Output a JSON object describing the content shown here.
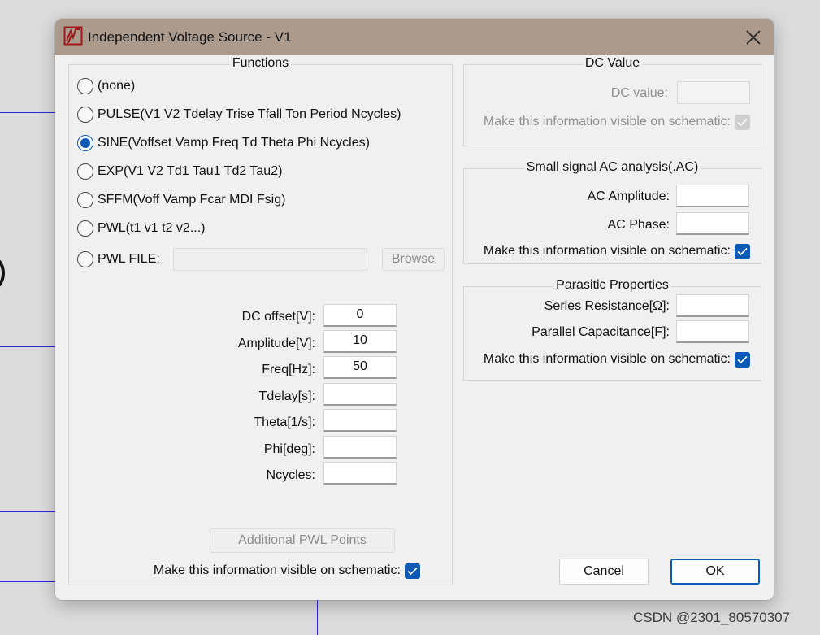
{
  "dialog": {
    "title": "Independent Voltage Source - V1",
    "title_icon": "ltspice-logo-icon",
    "close_icon": "close-icon"
  },
  "functions": {
    "title": "Functions",
    "options": [
      {
        "label": "(none)",
        "selected": false
      },
      {
        "label": "PULSE(V1 V2 Tdelay Trise Tfall Ton Period Ncycles)",
        "selected": false
      },
      {
        "label": "SINE(Voffset Vamp Freq Td Theta Phi Ncycles)",
        "selected": true
      },
      {
        "label": "EXP(V1 V2 Td1 Tau1 Td2 Tau2)",
        "selected": false
      },
      {
        "label": "SFFM(Voff Vamp Fcar MDI Fsig)",
        "selected": false
      },
      {
        "label": "PWL(t1 v1 t2 v2...)",
        "selected": false
      },
      {
        "label": "PWL FILE:",
        "selected": false
      }
    ],
    "pwl_file_value": "",
    "browse_label": "Browse",
    "params": [
      {
        "label": "DC offset[V]:",
        "value": "0"
      },
      {
        "label": "Amplitude[V]:",
        "value": "10"
      },
      {
        "label": "Freq[Hz]:",
        "value": "50"
      },
      {
        "label": "Tdelay[s]:",
        "value": ""
      },
      {
        "label": "Theta[1/s]:",
        "value": ""
      },
      {
        "label": "Phi[deg]:",
        "value": ""
      },
      {
        "label": "Ncycles:",
        "value": ""
      }
    ],
    "additional_pwl_label": "Additional PWL Points",
    "visible_label": "Make this information visible on schematic:",
    "visible_checked": true
  },
  "dc_value": {
    "title": "DC Value",
    "dc_label": "DC value:",
    "dc_value": "",
    "visible_label": "Make this information visible on schematic:",
    "visible_checked": true
  },
  "ac": {
    "title": "Small signal AC analysis(.AC)",
    "amplitude_label": "AC Amplitude:",
    "amplitude_value": "",
    "phase_label": "AC Phase:",
    "phase_value": "",
    "visible_label": "Make this information visible on schematic:",
    "visible_checked": true
  },
  "parasitic": {
    "title": "Parasitic Properties",
    "series_label": "Series Resistance[Ω]:",
    "series_value": "",
    "parallel_label": "Parallel Capacitance[F]:",
    "parallel_value": "",
    "visible_label": "Make this information visible on schematic:",
    "visible_checked": true
  },
  "buttons": {
    "cancel": "Cancel",
    "ok": "OK"
  },
  "colors": {
    "titlebar": "#ac9a8d",
    "accent": "#0a5ab5",
    "schematic_wire": "#2828d8"
  },
  "watermark": "CSDN @2301_80570307"
}
